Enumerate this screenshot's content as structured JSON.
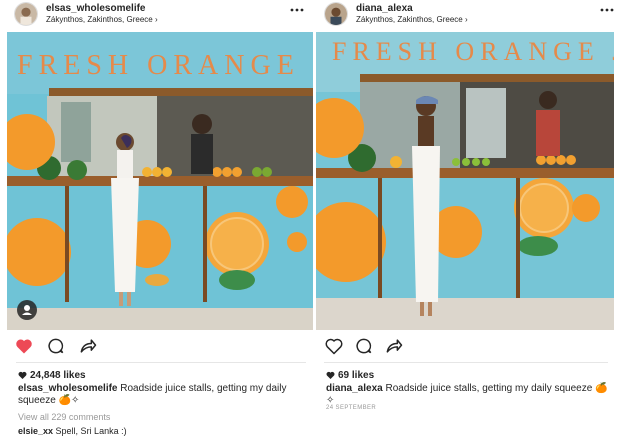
{
  "posts": [
    {
      "username": "elsas_wholesomelife",
      "location": "Zákynthos, Zakinthos, Greece",
      "liked": true,
      "likes": "24,848 likes",
      "caption_user": "elsas_wholesomelife",
      "caption_text": " Roadside juice stalls, getting my daily squeeze 🍊✧",
      "view_comments": "View all 229 comments",
      "comment_user": "elsie_xx",
      "comment_text": " Spell, Sri Lanka :)",
      "sign_text": "FRESH ORANGE JU"
    },
    {
      "username": "diana_alexa",
      "location": "Zákynthos, Zakinthos, Greece",
      "liked": false,
      "likes": "69 likes",
      "caption_user": "diana_alexa",
      "caption_text": " Roadside juice stalls, getting my daily squeeze 🍊✧",
      "date": "24 SEPTEMBER",
      "sign_text": "FRESH ORANGE JU"
    }
  ],
  "icons": {
    "more": "more-dots-icon",
    "like": "heart-icon",
    "comment": "comment-bubble-icon",
    "share": "share-arrow-icon",
    "tag": "user-tag-icon"
  },
  "colors": {
    "liked_heart": "#ed4956",
    "wall_blue": "#6fc3d6",
    "orange": "#f39a2b",
    "sign_text": "#e58a4a"
  }
}
